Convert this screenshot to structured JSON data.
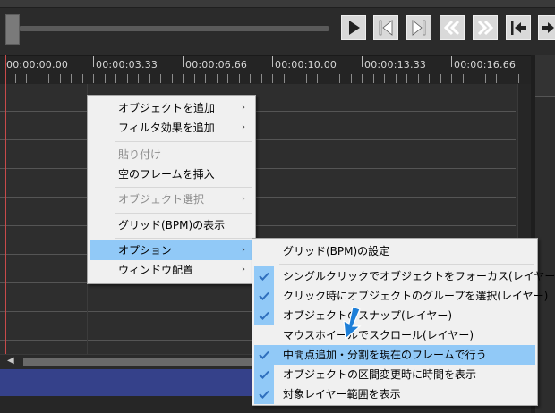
{
  "ruler": {
    "labels": [
      "00:00:00.00",
      "00:00:03.33",
      "00:00:06.66",
      "00:00:10.00",
      "00:00:13.33",
      "00:00:16.66"
    ]
  },
  "transport": {
    "buttons": [
      "play-icon",
      "step-back-icon",
      "step-forward-icon",
      "rewind-icon",
      "fast-forward-icon",
      "skip-to-start-icon",
      "skip-to-end-icon"
    ]
  },
  "context_menu": {
    "items": [
      {
        "label": "オブジェクトを追加",
        "submenu": true,
        "disabled": false
      },
      {
        "label": "フィルタ効果を追加",
        "submenu": true,
        "disabled": false
      },
      {
        "label": "貼り付け",
        "submenu": false,
        "disabled": true
      },
      {
        "label": "空のフレームを挿入",
        "submenu": false,
        "disabled": false
      },
      {
        "label": "オブジェクト選択",
        "submenu": true,
        "disabled": true
      },
      {
        "label": "グリッド(BPM)の表示",
        "submenu": false,
        "disabled": false
      },
      {
        "label": "オプション",
        "submenu": true,
        "disabled": false,
        "highlighted": true
      },
      {
        "label": "ウィンドウ配置",
        "submenu": true,
        "disabled": false
      }
    ]
  },
  "options_menu": {
    "items": [
      {
        "label": "グリッド(BPM)の設定",
        "checked": false
      },
      {
        "label": "シングルクリックでオブジェクトをフォーカス(レイヤー)",
        "checked": true
      },
      {
        "label": "クリック時にオブジェクトのグループを選択(レイヤー)",
        "checked": true
      },
      {
        "label": "オブジェクトのスナップ(レイヤー)",
        "checked": true
      },
      {
        "label": "マウスホイールでスクロール(レイヤー)",
        "checked": false
      },
      {
        "label": "中間点追加・分割を現在のフレームで行う",
        "checked": true,
        "highlighted": true
      },
      {
        "label": "オブジェクトの区間変更時に時間を表示",
        "checked": true
      },
      {
        "label": "対象レイヤー範囲を表示",
        "checked": true
      }
    ]
  },
  "colors": {
    "highlight": "#91c9f7",
    "check": "#2f6fbd",
    "pointer": "#1e7fd8",
    "bottom_band": "#35418a"
  }
}
